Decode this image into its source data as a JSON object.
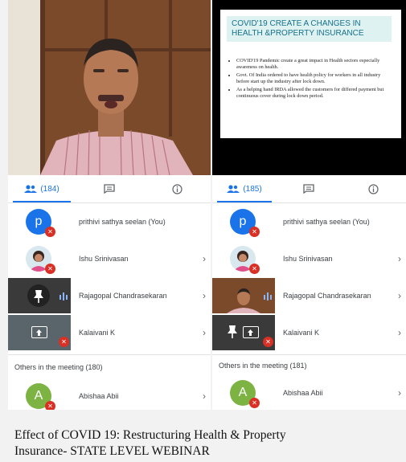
{
  "left": {
    "tabs": {
      "people_count": "(184)"
    },
    "participants": [
      {
        "initial": "p",
        "name": "prithivi sathya seelan (You)"
      },
      {
        "name": "Ishu Srinivasan"
      },
      {
        "name": "Rajagopal Chandrasekaran"
      },
      {
        "name": "Kalaivani K"
      }
    ],
    "others_label": "Others in the meeting (180)",
    "other": {
      "initial": "A",
      "name": "Abishaa Abii"
    }
  },
  "right": {
    "tabs": {
      "people_count": "(185)"
    },
    "slide": {
      "title": "COVID'19 CREATE A CHANGES IN HEALTH &PROPERTY INSURANCE",
      "bullets": [
        "COVID'19 Pandemic create a great impact in Health sectors especially awareness on health.",
        "Govt. Of India ordered to have health policy for workers in all industry before start up the industry after lock down.",
        "As a helping hand IRDA allowed the customers for differed payment but continuous cover during lock down period."
      ]
    },
    "participants": [
      {
        "initial": "p",
        "name": "prithivi sathya seelan (You)"
      },
      {
        "name": "Ishu Srinivasan"
      },
      {
        "name": "Rajagopal Chandrasekaran"
      },
      {
        "name": "Kalaivani K"
      }
    ],
    "others_label": "Others in the meeting (181)",
    "other": {
      "initial": "A",
      "name": "Abishaa Abii"
    }
  },
  "caption": {
    "line1": "Effect of COVID 19: Restructuring Health & Property",
    "line2": "Insurance- STATE LEVEL WEBINAR"
  },
  "colors": {
    "accent": "#1a73e8",
    "muted": "#d93025",
    "avatar_p": "#1a73e8",
    "avatar_a": "#7cb342"
  }
}
